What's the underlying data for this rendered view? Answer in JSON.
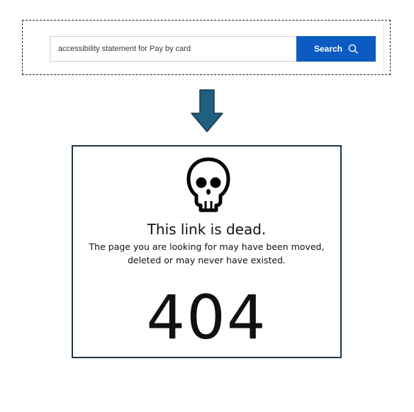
{
  "search": {
    "value": "accessibility statement for Pay by card",
    "button_label": "Search",
    "button_color": "#0b5bc2",
    "icon": "search-icon"
  },
  "transition": {
    "icon": "arrow-down-icon",
    "color": "#1f5f80"
  },
  "error": {
    "icon": "skull-icon",
    "title": "This link is dead.",
    "message_line1": "The page you are looking for may have been moved,",
    "message_line2": "deleted or may never have existed.",
    "code": "404",
    "border_color": "#1d3647"
  }
}
